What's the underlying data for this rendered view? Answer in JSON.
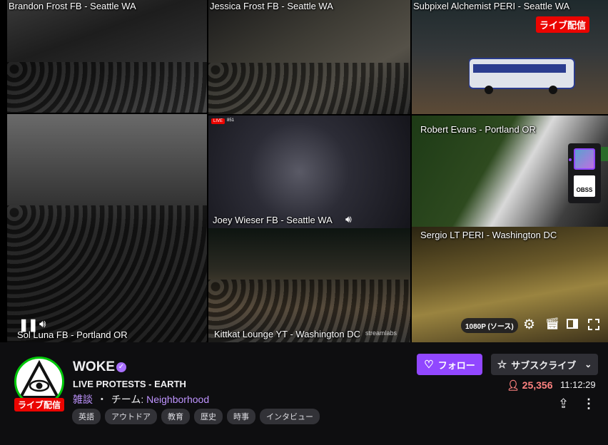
{
  "tiles": [
    {
      "label": "Brandon Frost FB - Seattle WA"
    },
    {
      "label": "Jessica Frost FB - Seattle WA"
    },
    {
      "label": "Subpixel Alchemist PERI - Seattle WA"
    },
    {
      "label": "Sol Luna FB - Portland OR"
    },
    {
      "label": "Joey Wieser FB - Seattle WA"
    },
    {
      "label": "Robert Evans - Portland OR"
    },
    {
      "label": "Kittkat Lounge YT - Washington DC"
    },
    {
      "label": "Sergio LT PERI - Washington DC"
    }
  ],
  "overlay": {
    "live_badge": "ライブ配信",
    "mini_live": "LIVE",
    "mini_viewers": "851",
    "obs_label": "OBSS",
    "streamlabs": "streamlabs"
  },
  "player": {
    "quality": "1080P (ソース)"
  },
  "channel": {
    "name": "WOKE",
    "live_label": "ライブ配信",
    "title": "LIVE PROTESTS - EARTH",
    "category": "雑談",
    "separator": "・",
    "team_prefix": "チーム: ",
    "team": "Neighborhood",
    "tags": [
      "英語",
      "アウトドア",
      "教育",
      "歴史",
      "時事",
      "インタビュー"
    ],
    "follow_label": "フォロー",
    "subscribe_label": "サブスクライブ",
    "viewers": "25,356",
    "uptime": "11:12:29"
  },
  "colors": {
    "accent": "#9147ff",
    "live": "#eb0400",
    "viewers": "#ff8280"
  }
}
